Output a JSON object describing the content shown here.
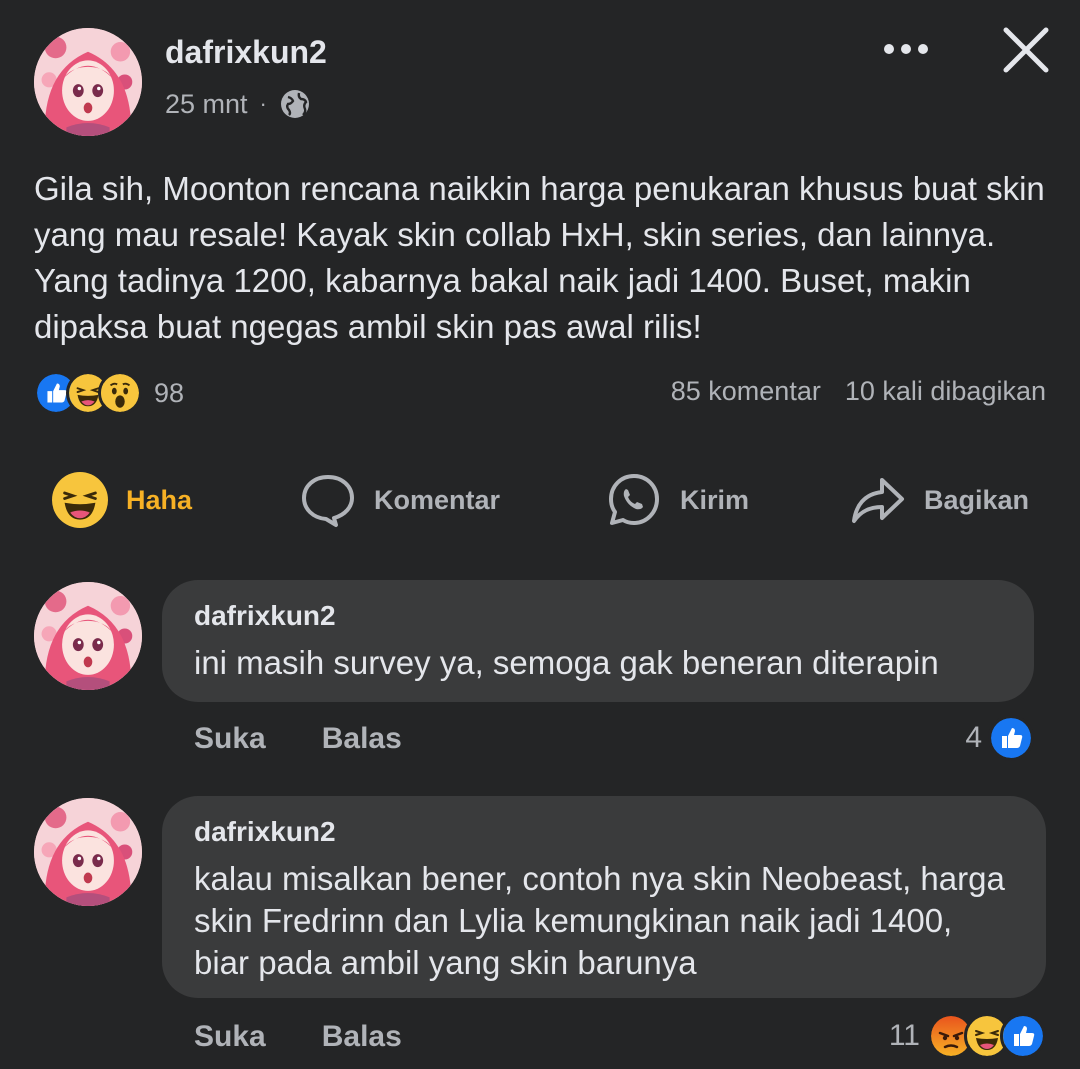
{
  "post": {
    "author": "dafrixkun2",
    "time": "25 mnt",
    "separator": "·",
    "privacy_icon": "globe-icon",
    "text": "Gila sih, Moonton rencana naikkin harga penukaran khusus buat skin yang mau resale! Kayak skin collab HxH, skin series, dan lainnya. Yang tadinya 1200, kabarnya bakal naik jadi 1400. Buset, makin dipaksa buat ngegas ambil skin pas awal rilis!",
    "reaction_icons": [
      "like-icon",
      "haha-icon",
      "wow-icon"
    ],
    "reaction_count": "98",
    "comments_count": "85 komentar",
    "shares_count": "10 kali dibagikan"
  },
  "actions": {
    "react_label": "Haha",
    "comment_label": "Komentar",
    "send_label": "Kirim",
    "share_label": "Bagikan"
  },
  "comments": [
    {
      "author": "dafrixkun2",
      "text": "ini masih survey ya, semoga gak beneran diterapin",
      "like_label": "Suka",
      "reply_label": "Balas",
      "reaction_count": "4",
      "reaction_icons": [
        "like-icon"
      ]
    },
    {
      "author": "dafrixkun2",
      "text": "kalau misalkan bener, contoh nya skin Neobeast, harga skin Fredrinn dan Lylia kemungkinan naik jadi 1400, biar pada ambil yang skin barunya",
      "like_label": "Suka",
      "reply_label": "Balas",
      "reaction_count": "11",
      "reaction_icons": [
        "angry-icon",
        "haha-icon",
        "like-icon"
      ]
    }
  ],
  "colors": {
    "background": "#242526",
    "bubble": "#3a3b3c",
    "text_primary": "#e4e6eb",
    "text_secondary": "#b0b3b8",
    "haha_active": "#f7b125",
    "like_blue": "#1877f2"
  }
}
